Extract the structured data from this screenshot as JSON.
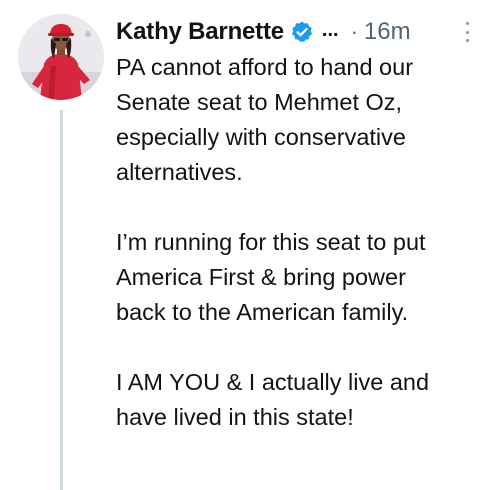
{
  "tweet": {
    "author_name": "Kathy Barnette",
    "truncation": "...",
    "separator": "·",
    "time": "16m",
    "paragraphs": [
      {
        "lines": [
          "PA cannot afford to hand our",
          "Senate seat to Mehmet Oz,",
          "especially with conservative",
          "alternatives."
        ]
      },
      {
        "lines": [
          "I’m running for this seat to put",
          "America First & bring power",
          "back to the American family."
        ]
      },
      {
        "lines": [
          "I AM YOU & I actually live and",
          "have lived in this state!"
        ]
      }
    ]
  },
  "icons": {
    "verified": "verified-badge-icon",
    "more": "more-options-icon"
  },
  "colors": {
    "verified_blue": "#1d9bf0",
    "secondary_text": "#536471",
    "thread_line": "#cfd9de"
  }
}
